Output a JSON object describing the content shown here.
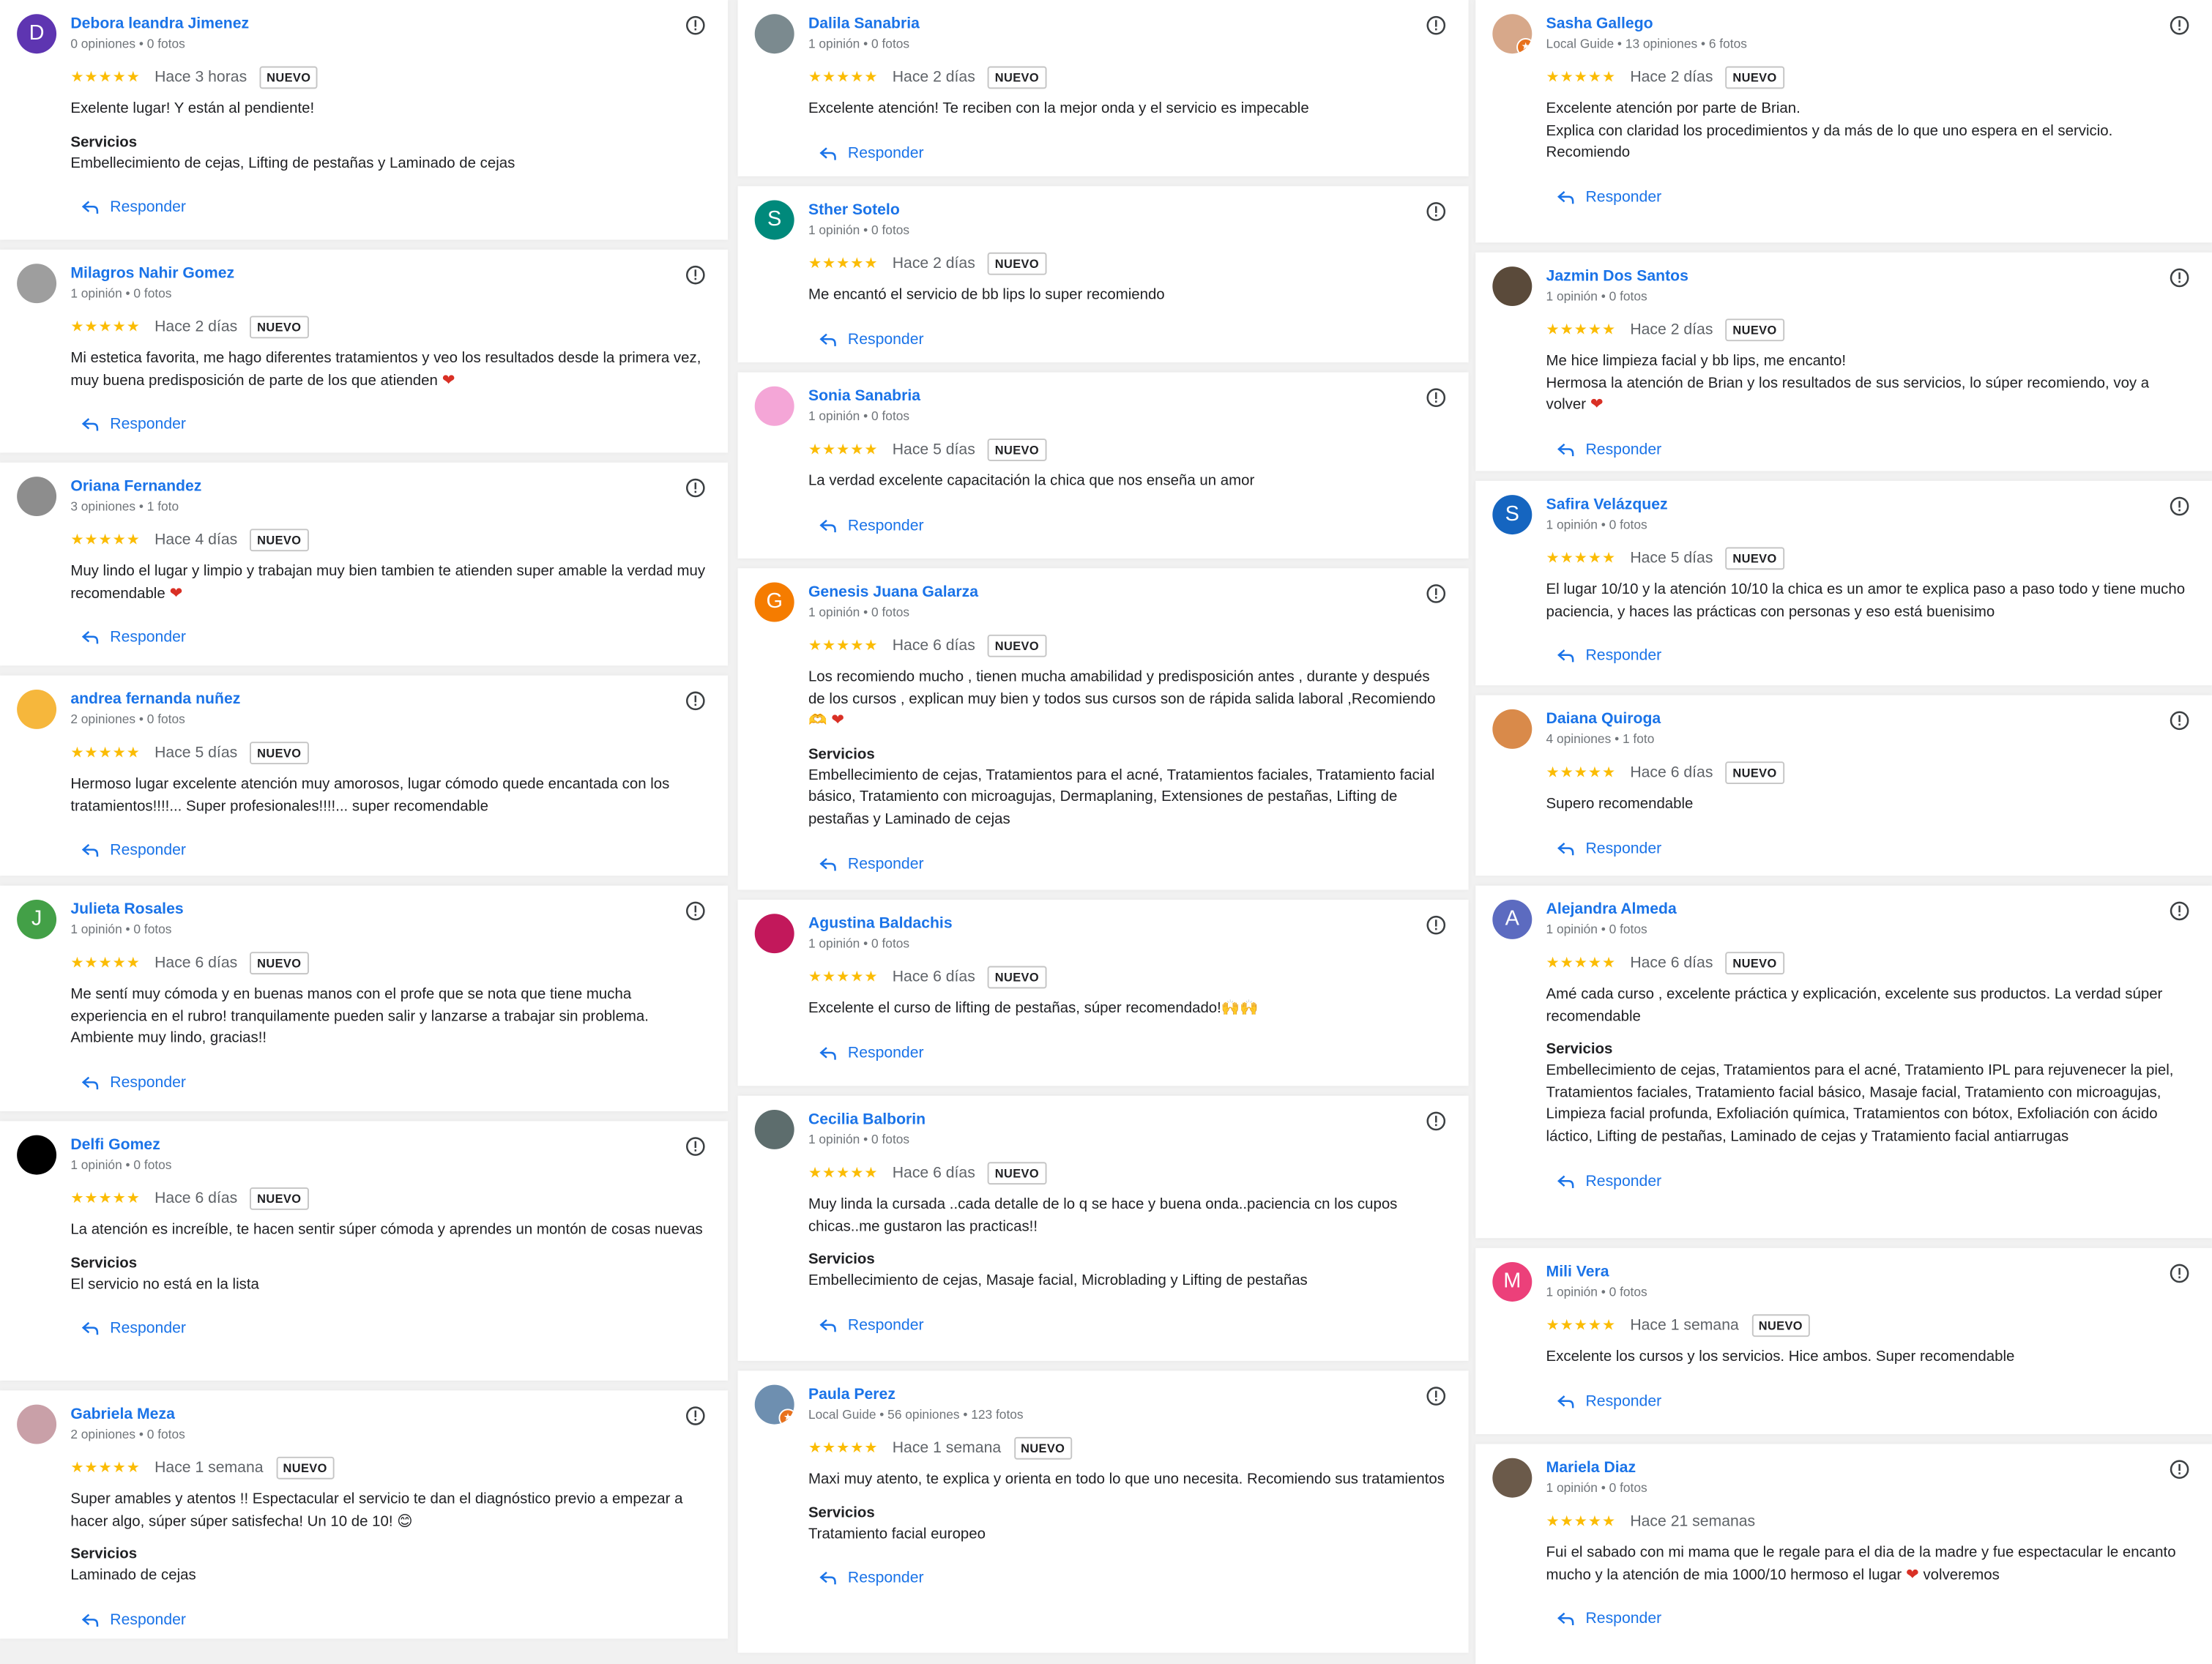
{
  "colors": {
    "link": "#1a73e8",
    "star": "#fbbc04",
    "meta": "#70757a",
    "heart": "#d93025"
  },
  "reply_label": "Responder",
  "services_label": "Servicios",
  "new_badge": "NUEVO",
  "columns": [
    [
      {
        "name": "Debora leandra Jimenez",
        "meta": "0 opiniones • 0 fotos",
        "avatar_letter": "D",
        "avatar_color": "#5e35b1",
        "stars": "★★★★★",
        "when": "Hace 3 horas",
        "is_new": true,
        "text": "Exelente lugar! Y están al pendiente!",
        "heart": false,
        "services": "Embellecimiento de cejas, Lifting de pestañas y Laminado de cejas"
      },
      {
        "name": "Milagros Nahir Gomez",
        "meta": "1 opinión • 0 fotos",
        "avatar_letter": "",
        "avatar_color": "#9e9e9e",
        "stars": "★★★★★",
        "when": "Hace 2 días",
        "is_new": true,
        "text": "Mi estetica favorita, me hago diferentes tratamientos y veo los resultados desde la primera vez, muy buena predisposición de parte de los que atienden",
        "heart": true,
        "services": null
      },
      {
        "name": "Oriana Fernandez",
        "meta": "3 opiniones • 1 foto",
        "avatar_letter": "",
        "avatar_color": "#8d8d8d",
        "stars": "★★★★★",
        "when": "Hace 4 días",
        "is_new": true,
        "text": "Muy lindo el lugar y limpio y trabajan muy bien tambien te atienden super amable la verdad muy recomendable",
        "heart": true,
        "services": null
      },
      {
        "name": "andrea fernanda nuñez",
        "meta": "2 opiniones • 0 fotos",
        "avatar_letter": "",
        "avatar_color": "#f6b73c",
        "stars": "★★★★★",
        "when": "Hace 5 días",
        "is_new": true,
        "text": "Hermoso lugar excelente atención muy amorosos, lugar cómodo quede encantada con los tratamientos!!!!... Super profesionales!!!!... super recomendable",
        "heart": false,
        "services": null
      },
      {
        "name": "Julieta Rosales",
        "meta": "1 opinión • 0 fotos",
        "avatar_letter": "J",
        "avatar_color": "#43a047",
        "stars": "★★★★★",
        "when": "Hace 6 días",
        "is_new": true,
        "text": "Me sentí muy cómoda y en buenas manos con el profe que se nota que tiene mucha experiencia en el rubro! tranquilamente pueden salir y lanzarse a trabajar sin problema. Ambiente muy lindo, gracias!!",
        "heart": false,
        "services": null
      },
      {
        "name": "Delfi Gomez",
        "meta": "1 opinión • 0 fotos",
        "avatar_letter": "",
        "avatar_color": "#000000",
        "stars": "★★★★★",
        "when": "Hace 6 días",
        "is_new": true,
        "text": "La atención es increíble, te hacen sentir súper cómoda y aprendes un montón de cosas nuevas",
        "heart": false,
        "services": "El servicio no está en la lista"
      },
      {
        "name": "Gabriela Meza",
        "meta": "2 opiniones • 0 fotos",
        "avatar_letter": "",
        "avatar_color": "#c9a0a8",
        "stars": "★★★★★",
        "when": "Hace 1 semana",
        "is_new": true,
        "text": "Super amables y atentos !! Espectacular el servicio te dan el diagnóstico previo a empezar a hacer algo, súper súper satisfecha! Un 10 de 10! 😊",
        "heart": false,
        "services": "Laminado de cejas"
      }
    ],
    [
      {
        "name": "Dalila Sanabria",
        "meta": "1 opinión • 0 fotos",
        "avatar_letter": "",
        "avatar_color": "#7b8a8f",
        "stars": "★★★★★",
        "when": "Hace 2 días",
        "is_new": true,
        "text": "Excelente atención! Te reciben con la mejor onda y el servicio es impecable",
        "heart": false,
        "services": null
      },
      {
        "name": "Sther Sotelo",
        "meta": "1 opinión • 0 fotos",
        "avatar_letter": "S",
        "avatar_color": "#00897b",
        "stars": "★★★★★",
        "when": "Hace 2 días",
        "is_new": true,
        "text": "Me encantó el servicio de bb lips lo super recomiendo",
        "heart": false,
        "services": null
      },
      {
        "name": "Sonia Sanabria",
        "meta": "1 opinión • 0 fotos",
        "avatar_letter": "",
        "avatar_color": "#f4a6d7",
        "stars": "★★★★★",
        "when": "Hace 5 días",
        "is_new": true,
        "text": "La verdad excelente capacitación la chica que nos enseña un amor",
        "heart": false,
        "services": null
      },
      {
        "name": "Genesis Juana Galarza",
        "meta": "1 opinión • 0 fotos",
        "avatar_letter": "G",
        "avatar_color": "#f57c00",
        "stars": "★★★★★",
        "when": "Hace 6 días",
        "is_new": true,
        "text": "Los recomiendo mucho , tienen mucha amabilidad y predisposición antes , durante y después de los cursos , explican muy bien y todos sus cursos son de rápida salida laboral ,Recomiendo 🫶",
        "heart": true,
        "services": "Embellecimiento de cejas, Tratamientos para el acné, Tratamientos faciales, Tratamiento facial básico, Tratamiento con microagujas, Dermaplaning, Extensiones de pestañas, Lifting de pestañas y Laminado de cejas"
      },
      {
        "name": "Agustina Baldachis",
        "meta": "1 opinión • 0 fotos",
        "avatar_letter": "",
        "avatar_color": "#c2185b",
        "stars": "★★★★★",
        "when": "Hace 6 días",
        "is_new": true,
        "text": "Excelente el curso de lifting de pestañas, súper recomendado!🙌🙌",
        "heart": false,
        "services": null
      },
      {
        "name": "Cecilia Balborin",
        "meta": "1 opinión • 0 fotos",
        "avatar_letter": "",
        "avatar_color": "#5d6d6d",
        "stars": "★★★★★",
        "when": "Hace 6 días",
        "is_new": true,
        "text": "Muy linda la cursada ..cada detalle de lo q se hace y buena onda..paciencia cn los cupos chicas..me gustaron las practicas!!",
        "heart": false,
        "services": "Embellecimiento de cejas, Masaje facial, Microblading y Lifting de pestañas"
      },
      {
        "name": "Paula Perez",
        "meta": "Local Guide • 56 opiniones • 123 fotos",
        "avatar_letter": "",
        "avatar_color": "#6e8fb0",
        "guide": true,
        "stars": "★★★★★",
        "when": "Hace 1 semana",
        "is_new": true,
        "text": "Maxi muy atento, te explica y orienta en todo lo que uno necesita. Recomiendo sus tratamientos",
        "heart": false,
        "services": "Tratamiento facial europeo"
      }
    ],
    [
      {
        "name": "Sasha Gallego",
        "meta": "Local Guide • 13 opiniones • 6 fotos",
        "avatar_letter": "",
        "avatar_color": "#d7a88a",
        "guide": true,
        "stars": "★★★★★",
        "when": "Hace 2 días",
        "is_new": true,
        "text": "Excelente atención por parte de Brian.\nExplica con claridad los procedimientos y da más de lo que uno espera en el servicio.\nRecomiendo",
        "heart": false,
        "services": null
      },
      {
        "name": "Jazmin Dos Santos",
        "meta": "1 opinión • 0 fotos",
        "avatar_letter": "",
        "avatar_color": "#5a4a3a",
        "stars": "★★★★★",
        "when": "Hace 2 días",
        "is_new": true,
        "text": "Me hice limpieza facial y bb lips, me encanto!\nHermosa la atención de Brian y los resultados de sus servicios, lo súper recomiendo, voy a volver",
        "heart": true,
        "services": null
      },
      {
        "name": "Safira Velázquez",
        "meta": "1 opinión • 0 fotos",
        "avatar_letter": "S",
        "avatar_color": "#1565c0",
        "stars": "★★★★★",
        "when": "Hace 5 días",
        "is_new": true,
        "text": "El lugar 10/10 y la atención 10/10 la chica es un amor te explica paso a paso todo y tiene mucho paciencia, y haces las prácticas con personas y eso está buenisimo",
        "heart": false,
        "services": null
      },
      {
        "name": "Daiana Quiroga",
        "meta": "4 opiniones • 1 foto",
        "avatar_letter": "",
        "avatar_color": "#d98a4a",
        "stars": "★★★★★",
        "when": "Hace 6 días",
        "is_new": true,
        "text": "Supero recomendable",
        "heart": false,
        "services": null
      },
      {
        "name": "Alejandra Almeda",
        "meta": "1 opinión • 0 fotos",
        "avatar_letter": "A",
        "avatar_color": "#5c6bc0",
        "stars": "★★★★★",
        "when": "Hace 6 días",
        "is_new": true,
        "text": "Amé cada curso , excelente práctica y explicación, excelente sus productos. La verdad súper recomendable",
        "heart": false,
        "services": "Embellecimiento de cejas, Tratamientos para el acné, Tratamiento IPL para rejuvenecer la piel, Tratamientos faciales, Tratamiento facial básico, Masaje facial, Tratamiento con microagujas, Limpieza facial profunda, Exfoliación química, Tratamientos con bótox, Exfoliación con ácido láctico, Lifting de pestañas, Laminado de cejas y Tratamiento facial antiarrugas"
      },
      {
        "name": "Mili Vera",
        "meta": "1 opinión • 0 fotos",
        "avatar_letter": "M",
        "avatar_color": "#ec407a",
        "stars": "★★★★★",
        "when": "Hace 1 semana",
        "is_new": true,
        "text": "Excelente los cursos y los servicios. Hice ambos. Super recomendable",
        "heart": false,
        "services": null
      },
      {
        "name": "Mariela Diaz",
        "meta": "1 opinión • 0 fotos",
        "avatar_letter": "",
        "avatar_color": "#6b5a4a",
        "stars": "★★★★★",
        "when": "Hace 21 semanas",
        "is_new": false,
        "text": "Fui el sabado con mi mama que le regale para el dia de la madre y fue espectacular le encanto mucho y la atención de mia 1000/10 hermoso el lugar",
        "heart": true,
        "text_after": " volveremos",
        "services": null
      }
    ]
  ]
}
